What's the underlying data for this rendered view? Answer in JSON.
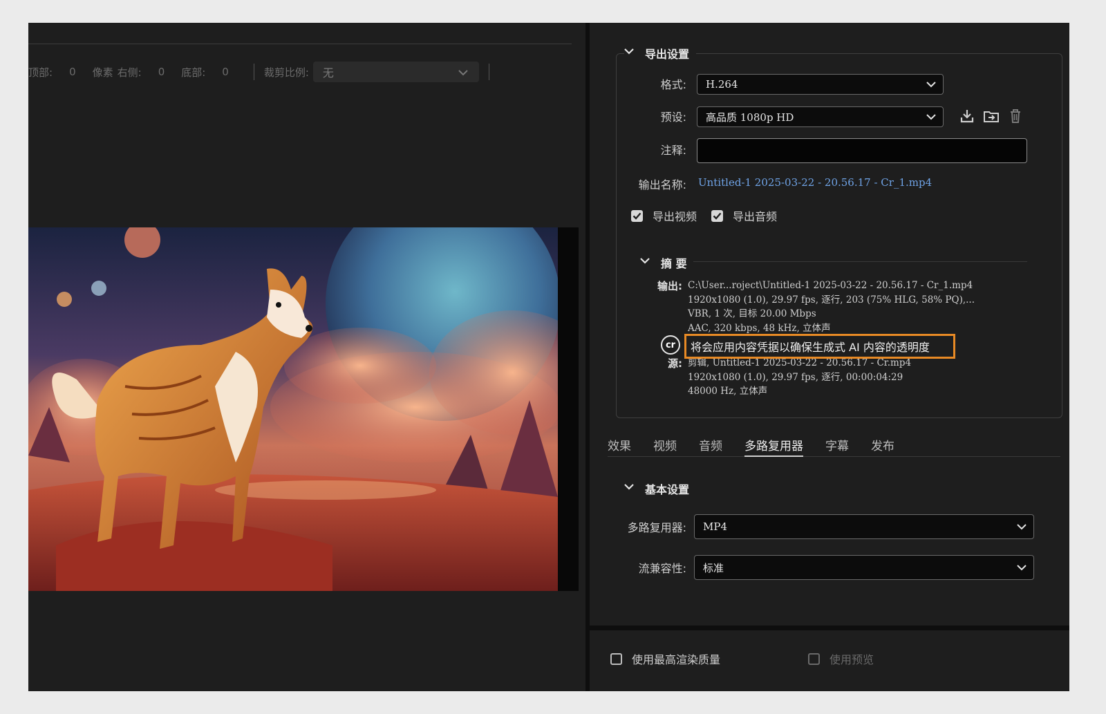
{
  "crop": {
    "top_label": "顶部:",
    "top_value": "0",
    "px_label": "像素",
    "right_label": "右侧:",
    "right_value": "0",
    "bottom_label": "底部:",
    "bottom_value": "0",
    "ratio_label": "裁剪比例:",
    "ratio_value": "无"
  },
  "export_settings": {
    "section_title": "导出设置",
    "format_label": "格式:",
    "format_value": "H.264",
    "preset_label": "预设:",
    "preset_value": "高品质 1080p HD",
    "comment_label": "注释:",
    "comment_value": "",
    "output_name_label": "输出名称:",
    "output_name_value": "Untitled-1 2025-03-22 - 20.56.17 - Cr_1.mp4",
    "export_video_label": "导出视频",
    "export_video_checked": true,
    "export_audio_label": "导出音频",
    "export_audio_checked": true
  },
  "summary": {
    "title": "摘 要",
    "output_label": "输出:",
    "output_lines": [
      "C:\\User...roject\\Untitled-1 2025-03-22 - 20.56.17 - Cr_1.mp4",
      "1920x1080 (1.0), 29.97 fps, 逐行, 203 (75% HLG, 58% PQ),...",
      "VBR, 1 次, 目标 20.00 Mbps",
      "AAC, 320 kbps, 48 kHz, 立体声"
    ],
    "cr_badge": "cr",
    "tooltip": "将会应用内容凭据以确保生成式 AI 内容的透明度",
    "source_label": "源:",
    "source_lines": [
      "剪辑, Untitled-1 2025-03-22 - 20.56.17 - Cr.mp4",
      "1920x1080 (1.0), 29.97 fps, 逐行, 00:00:04:29",
      "48000 Hz, 立体声"
    ]
  },
  "tabs": [
    {
      "label": "效果",
      "active": false
    },
    {
      "label": "视频",
      "active": false
    },
    {
      "label": "音频",
      "active": false
    },
    {
      "label": "多路复用器",
      "active": true
    },
    {
      "label": "字幕",
      "active": false
    },
    {
      "label": "发布",
      "active": false
    }
  ],
  "basic": {
    "section_title": "基本设置",
    "muxer_label": "多路复用器:",
    "muxer_value": "MP4",
    "compat_label": "流兼容性:",
    "compat_value": "标准"
  },
  "footer": {
    "max_quality_label": "使用最高渲染质量",
    "max_quality_checked": false,
    "use_preview_label": "使用预览",
    "use_preview_checked": false
  },
  "colors": {
    "accent_link": "#6fa3e6",
    "highlight_border": "#e88a25",
    "panel_bg": "#1e1e1e"
  },
  "icons": [
    "chevron-down-icon",
    "save-preset-icon",
    "import-preset-icon",
    "delete-preset-icon",
    "content-credentials-icon",
    "checkmark-icon"
  ]
}
